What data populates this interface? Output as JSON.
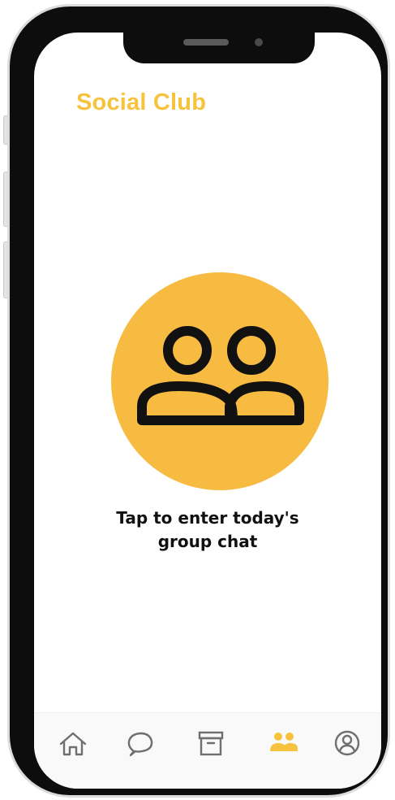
{
  "header": {
    "title": "Social Club"
  },
  "main": {
    "caption_line1": "Tap to enter today's",
    "caption_line2": "group chat",
    "icon": "group-icon"
  },
  "bottom_nav": {
    "items": [
      {
        "icon": "home-icon",
        "active": false
      },
      {
        "icon": "chat-bubble-icon",
        "active": false
      },
      {
        "icon": "archive-icon",
        "active": false
      },
      {
        "icon": "group-icon",
        "active": true
      },
      {
        "icon": "profile-icon",
        "active": false
      }
    ]
  },
  "colors": {
    "accent": "#f7c33f",
    "circle": "#f7bb41",
    "inactive_icon": "#6f6f6f",
    "text": "#111111",
    "frame": "#0d0d0d"
  }
}
